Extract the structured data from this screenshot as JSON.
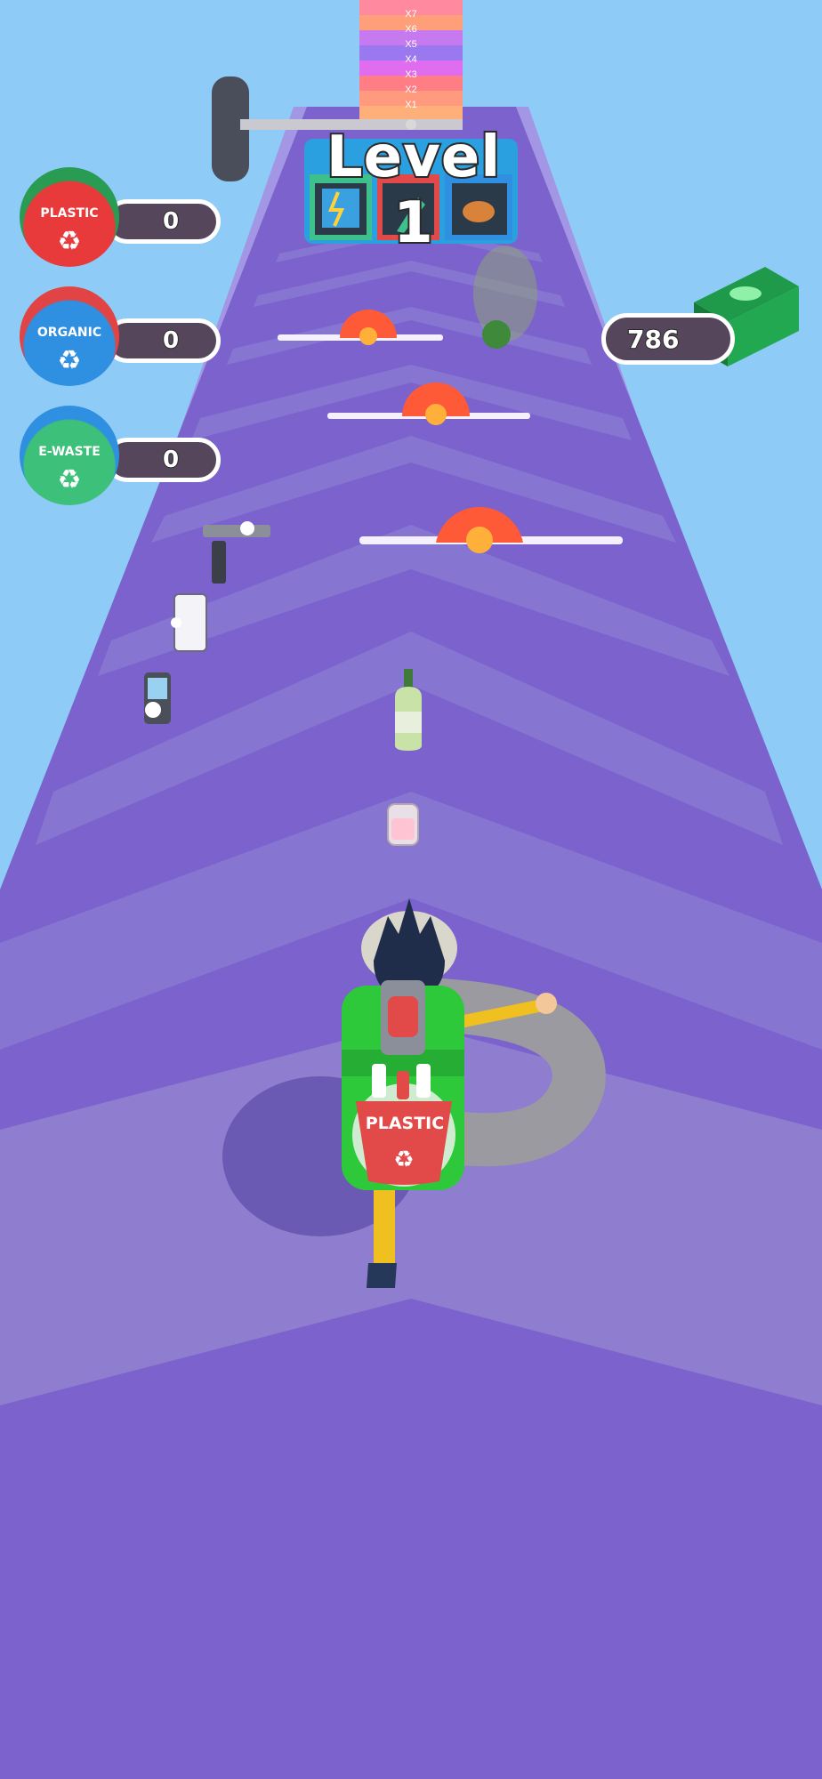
{
  "level": {
    "title": "Level 1"
  },
  "multipliers": [
    "X7",
    "X6",
    "X5",
    "X4",
    "X3",
    "X2",
    "X1"
  ],
  "bins": [
    {
      "label": "PLASTIC",
      "count": "0",
      "color": "#e83a3a",
      "rim": "#2a9b52"
    },
    {
      "label": "ORGANIC",
      "count": "0",
      "color": "#2f8fe0",
      "rim": "#e04444"
    },
    {
      "label": "E-WASTE",
      "count": "0",
      "color": "#3cc07a",
      "rim": "#2f8fe0"
    }
  ],
  "money": {
    "value": "786",
    "icon": "cash-stack-icon",
    "color": "#1f9a4a"
  },
  "player": {
    "backpack_label": "PLASTIC",
    "backpack_color": "#2ec93a"
  },
  "gate_icons": [
    "e-waste-icon",
    "organic-icon",
    "food-waste-icon"
  ],
  "colors": {
    "sky": "#8ecbf6",
    "track": "#7b62cc",
    "track_light": "#8f7ed0",
    "track_edge": "#a396e4"
  }
}
